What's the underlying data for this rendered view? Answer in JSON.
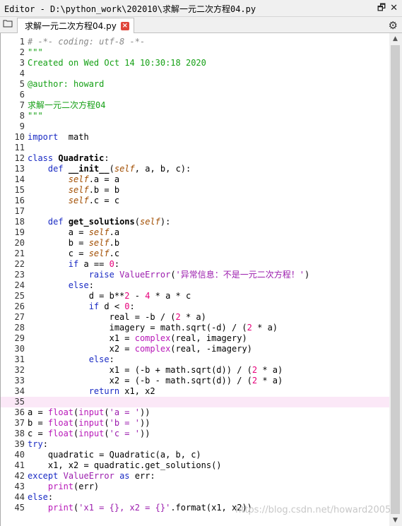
{
  "window": {
    "title": "Editor - D:\\python_work\\202010\\求解一元二次方程04.py",
    "restore_icon": "restore-icon",
    "close_icon": "close-icon"
  },
  "tabbar": {
    "browse_icon": "folder-icon",
    "tab_label": "求解一元二次方程04.py",
    "tab_close": "×",
    "settings_icon": "gear-icon"
  },
  "editor": {
    "current_line": 35,
    "lines": [
      {
        "n": "1",
        "seg": [
          [
            "comment",
            "# -*- coding: utf-8 -*-"
          ]
        ]
      },
      {
        "n": "2",
        "seg": [
          [
            "doc",
            "\"\"\""
          ]
        ]
      },
      {
        "n": "3",
        "seg": [
          [
            "doc",
            "Created on Wed Oct 14 10:30:18 2020"
          ]
        ]
      },
      {
        "n": "4",
        "seg": []
      },
      {
        "n": "5",
        "seg": [
          [
            "doc",
            "@author: howard"
          ]
        ]
      },
      {
        "n": "6",
        "seg": []
      },
      {
        "n": "7",
        "seg": [
          [
            "doc",
            "求解一元二次方程04"
          ]
        ]
      },
      {
        "n": "8",
        "seg": [
          [
            "doc",
            "\"\"\""
          ]
        ]
      },
      {
        "n": "9",
        "seg": []
      },
      {
        "n": "10",
        "seg": [
          [
            "kw",
            "import"
          ],
          [
            "",
            "  math"
          ]
        ]
      },
      {
        "n": "11",
        "seg": []
      },
      {
        "n": "12",
        "seg": [
          [
            "kw",
            "class"
          ],
          [
            "",
            " "
          ],
          [
            "cls",
            "Quadratic"
          ],
          [
            "",
            ":"
          ]
        ]
      },
      {
        "n": "13",
        "seg": [
          [
            "",
            "    "
          ],
          [
            "kw",
            "def"
          ],
          [
            "",
            " "
          ],
          [
            "cls",
            "__init__"
          ],
          [
            "",
            "("
          ],
          [
            "self",
            "self"
          ],
          [
            "",
            ", a, b, c):"
          ]
        ]
      },
      {
        "n": "14",
        "seg": [
          [
            "",
            "        "
          ],
          [
            "self",
            "self"
          ],
          [
            "",
            ".a = a"
          ]
        ]
      },
      {
        "n": "15",
        "seg": [
          [
            "",
            "        "
          ],
          [
            "self",
            "self"
          ],
          [
            "",
            ".b = b"
          ]
        ]
      },
      {
        "n": "16",
        "seg": [
          [
            "",
            "        "
          ],
          [
            "self",
            "self"
          ],
          [
            "",
            ".c = c"
          ]
        ]
      },
      {
        "n": "17",
        "seg": []
      },
      {
        "n": "18",
        "seg": [
          [
            "",
            "    "
          ],
          [
            "kw",
            "def"
          ],
          [
            "",
            " "
          ],
          [
            "cls",
            "get_solutions"
          ],
          [
            "",
            "("
          ],
          [
            "self",
            "self"
          ],
          [
            "",
            "):"
          ]
        ]
      },
      {
        "n": "19",
        "seg": [
          [
            "",
            "        a = "
          ],
          [
            "self",
            "self"
          ],
          [
            "",
            ".a"
          ]
        ]
      },
      {
        "n": "20",
        "seg": [
          [
            "",
            "        b = "
          ],
          [
            "self",
            "self"
          ],
          [
            "",
            ".b"
          ]
        ]
      },
      {
        "n": "21",
        "seg": [
          [
            "",
            "        c = "
          ],
          [
            "self",
            "self"
          ],
          [
            "",
            ".c"
          ]
        ]
      },
      {
        "n": "22",
        "seg": [
          [
            "",
            "        "
          ],
          [
            "kw",
            "if"
          ],
          [
            "",
            " a == "
          ],
          [
            "num",
            "0"
          ],
          [
            "",
            ":"
          ]
        ]
      },
      {
        "n": "23",
        "seg": [
          [
            "",
            "            "
          ],
          [
            "kw",
            "raise"
          ],
          [
            "",
            " "
          ],
          [
            "exc",
            "ValueError"
          ],
          [
            "",
            "("
          ],
          [
            "str",
            "'异常信息：不是一元二次方程！'"
          ],
          [
            "",
            ")"
          ]
        ]
      },
      {
        "n": "24",
        "seg": [
          [
            "",
            "        "
          ],
          [
            "kw",
            "else"
          ],
          [
            "",
            ":"
          ]
        ]
      },
      {
        "n": "25",
        "seg": [
          [
            "",
            "            d = b**"
          ],
          [
            "num",
            "2"
          ],
          [
            "",
            " - "
          ],
          [
            "num",
            "4"
          ],
          [
            "",
            " * a * c"
          ]
        ]
      },
      {
        "n": "26",
        "seg": [
          [
            "",
            "            "
          ],
          [
            "kw",
            "if"
          ],
          [
            "",
            " d < "
          ],
          [
            "num",
            "0"
          ],
          [
            "",
            ":"
          ]
        ]
      },
      {
        "n": "27",
        "seg": [
          [
            "",
            "                real = -b / ("
          ],
          [
            "num",
            "2"
          ],
          [
            "",
            " * a)"
          ]
        ]
      },
      {
        "n": "28",
        "seg": [
          [
            "",
            "                imagery = math.sqrt(-d) / ("
          ],
          [
            "num",
            "2"
          ],
          [
            "",
            " * a)"
          ]
        ]
      },
      {
        "n": "29",
        "seg": [
          [
            "",
            "                x1 = "
          ],
          [
            "builtin",
            "complex"
          ],
          [
            "",
            "(real, imagery)"
          ]
        ]
      },
      {
        "n": "30",
        "seg": [
          [
            "",
            "                x2 = "
          ],
          [
            "builtin",
            "complex"
          ],
          [
            "",
            "(real, -imagery)"
          ]
        ]
      },
      {
        "n": "31",
        "seg": [
          [
            "",
            "            "
          ],
          [
            "kw",
            "else"
          ],
          [
            "",
            ":"
          ]
        ]
      },
      {
        "n": "32",
        "seg": [
          [
            "",
            "                x1 = (-b + math.sqrt(d)) / ("
          ],
          [
            "num",
            "2"
          ],
          [
            "",
            " * a)"
          ]
        ]
      },
      {
        "n": "33",
        "seg": [
          [
            "",
            "                x2 = (-b - math.sqrt(d)) / ("
          ],
          [
            "num",
            "2"
          ],
          [
            "",
            " * a)"
          ]
        ]
      },
      {
        "n": "34",
        "seg": [
          [
            "",
            "            "
          ],
          [
            "kw",
            "return"
          ],
          [
            "",
            " x1, x2"
          ]
        ]
      },
      {
        "n": "35",
        "seg": []
      },
      {
        "n": "36",
        "seg": [
          [
            "",
            "a = "
          ],
          [
            "builtin",
            "float"
          ],
          [
            "",
            "("
          ],
          [
            "builtin",
            "input"
          ],
          [
            "",
            "("
          ],
          [
            "str",
            "'a = '"
          ],
          [
            "",
            "))"
          ]
        ]
      },
      {
        "n": "37",
        "seg": [
          [
            "",
            "b = "
          ],
          [
            "builtin",
            "float"
          ],
          [
            "",
            "("
          ],
          [
            "builtin",
            "input"
          ],
          [
            "",
            "("
          ],
          [
            "str",
            "'b = '"
          ],
          [
            "",
            "))"
          ]
        ]
      },
      {
        "n": "38",
        "seg": [
          [
            "",
            "c = "
          ],
          [
            "builtin",
            "float"
          ],
          [
            "",
            "("
          ],
          [
            "builtin",
            "input"
          ],
          [
            "",
            "("
          ],
          [
            "str",
            "'c = '"
          ],
          [
            "",
            "))"
          ]
        ]
      },
      {
        "n": "39",
        "seg": [
          [
            "kw",
            "try"
          ],
          [
            "",
            ":"
          ]
        ]
      },
      {
        "n": "40",
        "seg": [
          [
            "",
            "    quadratic = Quadratic(a, b, c)"
          ]
        ]
      },
      {
        "n": "41",
        "seg": [
          [
            "",
            "    x1, x2 = quadratic.get_solutions()"
          ]
        ]
      },
      {
        "n": "42",
        "seg": [
          [
            "kw",
            "except"
          ],
          [
            "",
            " "
          ],
          [
            "exc",
            "ValueError"
          ],
          [
            "",
            " "
          ],
          [
            "kw",
            "as"
          ],
          [
            "",
            " err:"
          ]
        ]
      },
      {
        "n": "43",
        "seg": [
          [
            "",
            "    "
          ],
          [
            "builtin",
            "print"
          ],
          [
            "",
            "(err)"
          ]
        ]
      },
      {
        "n": "44",
        "seg": [
          [
            "kw",
            "else"
          ],
          [
            "",
            ":"
          ]
        ]
      },
      {
        "n": "45",
        "seg": [
          [
            "",
            "    "
          ],
          [
            "builtin",
            "print"
          ],
          [
            "",
            "("
          ],
          [
            "str",
            "'x1 = {}, x2 = {}'"
          ],
          [
            "",
            ".format(x1, x2))"
          ]
        ]
      }
    ]
  },
  "watermark": "https://blog.csdn.net/howard2005"
}
